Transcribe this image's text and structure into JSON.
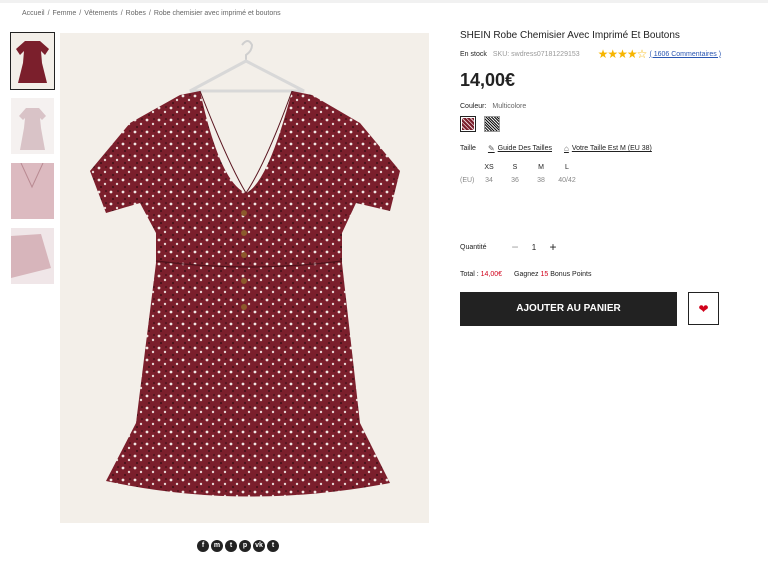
{
  "breadcrumb": [
    {
      "label": "Accueil"
    },
    {
      "label": "Femme"
    },
    {
      "label": "Vêtements"
    },
    {
      "label": "Robes"
    },
    {
      "label": "Robe chemisier avec imprimé et boutons"
    }
  ],
  "breadcrumb_sep": "/",
  "product": {
    "title": "SHEIN Robe Chemisier Avec Imprimé Et Boutons",
    "stock": "En stock",
    "sku": "SKU: swdress07181229153",
    "rating": 4.5,
    "stars": "★★★★☆",
    "reviews": "( 1606 Commentaires )",
    "price": "14,00€"
  },
  "color": {
    "label": "Couleur:",
    "value": "Multicolore"
  },
  "size": {
    "label": "Taille",
    "guide": "Guide Des Tailles",
    "fit": "Votre Taille Est M (EU 38)",
    "region": "(EU)",
    "sizes": [
      "XS",
      "S",
      "M",
      "L"
    ],
    "eu": [
      "34",
      "36",
      "38",
      "40/42"
    ]
  },
  "quantity": {
    "label": "Quantité",
    "minus": "−",
    "value": "1",
    "plus": "+"
  },
  "total": {
    "label": "Total :",
    "amount": "14,00€",
    "earn": "Gagnez",
    "points": "15",
    "points_label": "Bonus Points"
  },
  "actions": {
    "add_to_cart": "AJOUTER AU PANIER",
    "wishlist_icon": "heart-icon"
  },
  "share": [
    {
      "icon": "facebook-icon",
      "glyph": "f"
    },
    {
      "icon": "messenger-icon",
      "glyph": "m"
    },
    {
      "icon": "twitter-icon",
      "glyph": "t"
    },
    {
      "icon": "pinterest-icon",
      "glyph": "p"
    },
    {
      "icon": "vk-icon",
      "glyph": "vk"
    },
    {
      "icon": "tumblr-icon",
      "glyph": "t"
    }
  ],
  "colors": {
    "accent_red": "#d0021b",
    "button_dark": "#222222",
    "star": "#f7b500",
    "link_blue": "#2956b2",
    "dress": "#7b1f2c"
  }
}
